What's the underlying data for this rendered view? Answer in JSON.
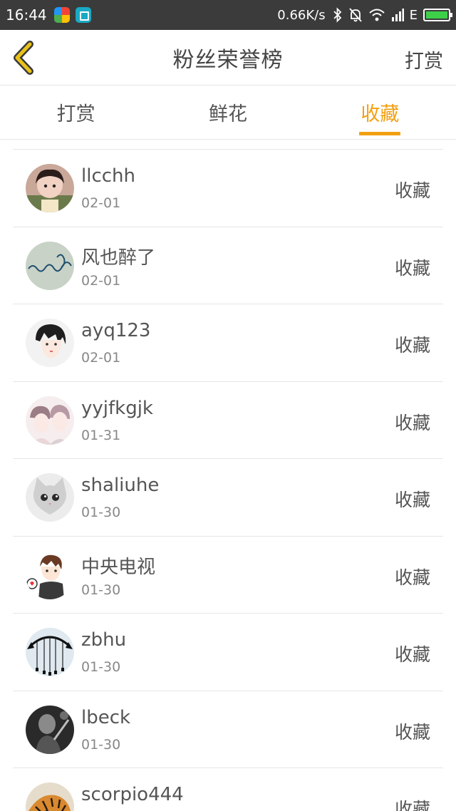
{
  "status_bar": {
    "time": "16:44",
    "speed": "0.66K/s",
    "network": "E",
    "icons": [
      "app-icon-colorful",
      "app-icon-crop",
      "bluetooth-icon",
      "bell-off-icon",
      "wifi-icon",
      "signal-icon",
      "battery-charging-icon"
    ]
  },
  "header": {
    "title": "粉丝荣誉榜",
    "right_action": "打赏",
    "back_icon": "chevron-left-icon"
  },
  "tabs": [
    {
      "label": "打赏",
      "active": false
    },
    {
      "label": "鲜花",
      "active": false
    },
    {
      "label": "收藏",
      "active": true
    }
  ],
  "colors": {
    "accent": "#f2a012",
    "back_icon": "#e8c21a",
    "status_bar_bg": "#3b3b3b"
  },
  "fans": [
    {
      "name": "llcchh",
      "date": "02-01",
      "action": "收藏",
      "avatar": "avatar-child-photo"
    },
    {
      "name": "风也醉了",
      "date": "02-01",
      "action": "收藏",
      "avatar": "avatar-handwriting"
    },
    {
      "name": "ayq123",
      "date": "02-01",
      "action": "收藏",
      "avatar": "avatar-anime-boy"
    },
    {
      "name": "yyjfkgjk",
      "date": "01-31",
      "action": "收藏",
      "avatar": "avatar-anime-couple"
    },
    {
      "name": "shaliuhe",
      "date": "01-30",
      "action": "收藏",
      "avatar": "avatar-cat"
    },
    {
      "name": "中央电视",
      "date": "01-30",
      "action": "收藏",
      "avatar": "avatar-cartoon-boy"
    },
    {
      "name": "zbhu",
      "date": "01-30",
      "action": "收藏",
      "avatar": "avatar-wind-chime"
    },
    {
      "name": "lbeck",
      "date": "01-30",
      "action": "收藏",
      "avatar": "avatar-bw-photo"
    },
    {
      "name": "scorpio444",
      "date": "",
      "action": "收藏",
      "avatar": "avatar-tiger"
    }
  ]
}
